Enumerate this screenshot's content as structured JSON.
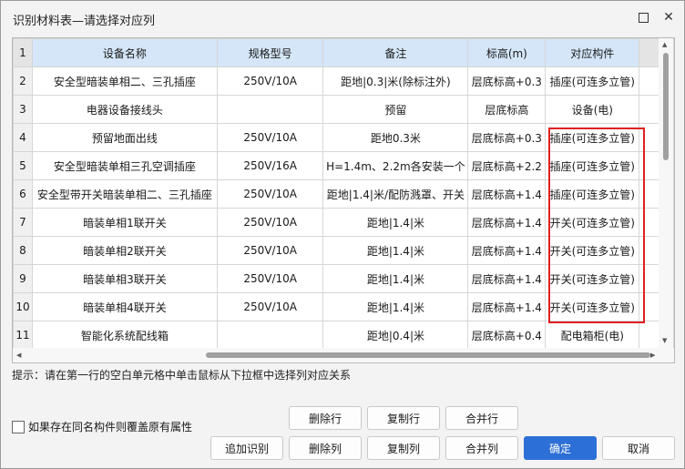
{
  "window": {
    "title": "识别材料表—请选择对应列"
  },
  "table": {
    "header_row_number": "1",
    "columns": [
      "设备名称",
      "规格型号",
      "备注",
      "标高(m)",
      "对应构件"
    ],
    "rows": [
      {
        "n": "2",
        "cells": [
          "安全型暗装单相二、三孔插座",
          "250V/10A",
          "距地|0.3|米(除标注外)",
          "层底标高+0.3",
          "插座(可连多立管)"
        ]
      },
      {
        "n": "3",
        "cells": [
          "电器设备接线头",
          "",
          "预留",
          "层底标高",
          "设备(电)"
        ]
      },
      {
        "n": "4",
        "cells": [
          "预留地面出线",
          "250V/10A",
          "距地0.3米",
          "层底标高+0.3",
          "插座(可连多立管)"
        ]
      },
      {
        "n": "5",
        "cells": [
          "安全型暗装单相三孔空调插座",
          "250V/16A",
          "H=1.4m、2.2m各安装一个",
          "层底标高+2.2",
          "插座(可连多立管)"
        ]
      },
      {
        "n": "6",
        "cells": [
          "安全型带开关暗装单相二、三孔插座",
          "250V/10A",
          "距地|1.4|米/配防溅罩、开关",
          "层底标高+1.4",
          "插座(可连多立管)"
        ]
      },
      {
        "n": "7",
        "cells": [
          "暗装单相1联开关",
          "250V/10A",
          "距地|1.4|米",
          "层底标高+1.4",
          "开关(可连多立管)"
        ]
      },
      {
        "n": "8",
        "cells": [
          "暗装单相2联开关",
          "250V/10A",
          "距地|1.4|米",
          "层底标高+1.4",
          "开关(可连多立管)"
        ]
      },
      {
        "n": "9",
        "cells": [
          "暗装单相3联开关",
          "250V/10A",
          "距地|1.4|米",
          "层底标高+1.4",
          "开关(可连多立管)"
        ]
      },
      {
        "n": "10",
        "cells": [
          "暗装单相4联开关",
          "250V/10A",
          "距地|1.4|米",
          "层底标高+1.4",
          "开关(可连多立管)"
        ]
      },
      {
        "n": "11",
        "cells": [
          "智能化系统配线箱",
          "",
          "距地|0.4|米",
          "层底标高+0.4",
          "配电箱柜(电)"
        ]
      }
    ]
  },
  "hint": "提示：请在第一行的空白单元格中单击鼠标从下拉框中选择列对应关系",
  "checkbox_label": "如果存在同名构件则覆盖原有属性",
  "buttons": {
    "delete_row": "删除行",
    "copy_row": "复制行",
    "merge_row": "合并行",
    "append_recognize": "追加识别",
    "delete_col": "删除列",
    "copy_col": "复制列",
    "merge_col": "合并列",
    "ok": "确定",
    "cancel": "取消"
  },
  "colors": {
    "accent": "#2c6fd6",
    "highlight_box": "#e02020",
    "header_selected": "#d4e6f8"
  }
}
